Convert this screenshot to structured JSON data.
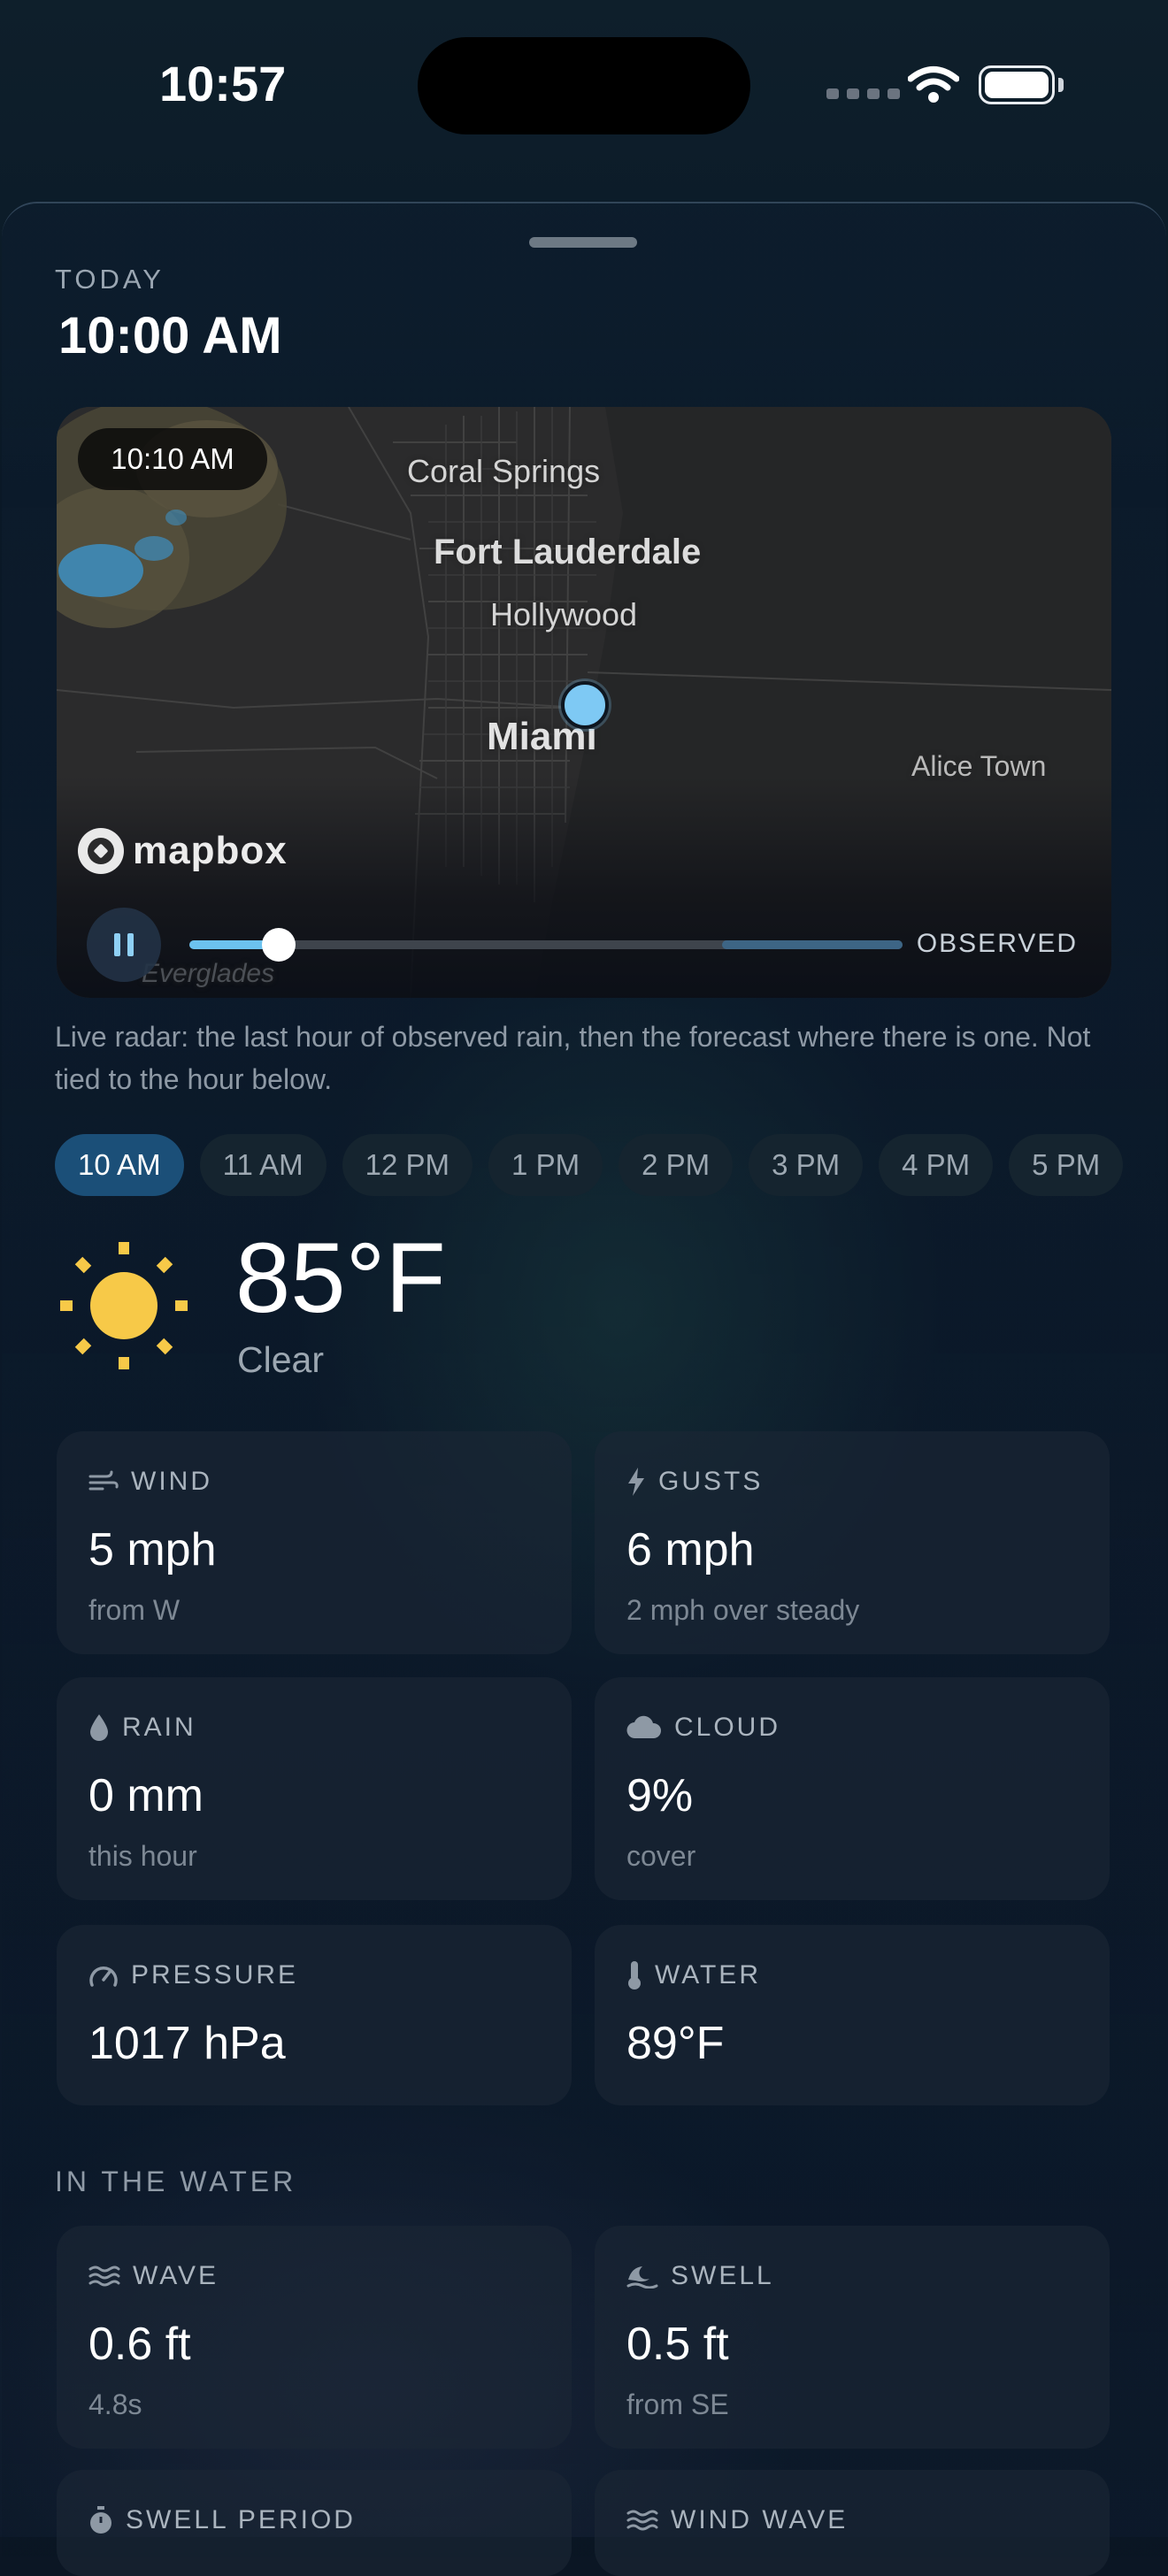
{
  "status_bar": {
    "time": "10:57"
  },
  "header": {
    "eyebrow": "TODAY",
    "time": "10:00 AM"
  },
  "radar": {
    "frame_time": "10:10 AM",
    "labels": {
      "coral_springs": "Coral Springs",
      "fort_lauderdale": "Fort Lauderdale",
      "hollywood": "Hollywood",
      "miami": "Miami",
      "alice_town": "Alice Town",
      "everglades": "Everglades"
    },
    "attribution": "mapbox",
    "progress": 0.125,
    "mode_label": "OBSERVED",
    "caption": "Live radar: the last hour of observed rain, then the forecast where there is one. Not tied to the hour below."
  },
  "hours": [
    "10 AM",
    "11 AM",
    "12 PM",
    "1 PM",
    "2 PM",
    "3 PM",
    "4 PM",
    "5 PM"
  ],
  "selected_hour": "10 AM",
  "current": {
    "icon": "sun-icon",
    "temperature": "85°F",
    "condition": "Clear"
  },
  "metrics": {
    "wind": {
      "label": "WIND",
      "value": "5 mph",
      "sub": "from W",
      "icon": "wind-icon"
    },
    "gusts": {
      "label": "GUSTS",
      "value": "6 mph",
      "sub": "2 mph over steady",
      "icon": "lightning-icon"
    },
    "rain": {
      "label": "RAIN",
      "value": "0 mm",
      "sub": "this hour",
      "icon": "droplet-icon"
    },
    "cloud": {
      "label": "CLOUD",
      "value": "9%",
      "sub": "cover",
      "icon": "cloud-icon"
    },
    "pressure": {
      "label": "PRESSURE",
      "value": "1017 hPa",
      "icon": "gauge-icon"
    },
    "water": {
      "label": "WATER",
      "value": "89°F",
      "icon": "thermometer-icon"
    }
  },
  "water_section": {
    "title": "IN THE WATER",
    "wave": {
      "label": "WAVE",
      "value": "0.6 ft",
      "sub": "4.8s",
      "icon": "waves-icon"
    },
    "swell": {
      "label": "SWELL",
      "value": "0.5 ft",
      "sub": "from SE",
      "icon": "swell-icon"
    },
    "swell_period": {
      "label": "SWELL PERIOD",
      "icon": "timer-icon"
    },
    "wind_wave": {
      "label": "WIND WAVE",
      "icon": "waves-icon"
    }
  },
  "colors": {
    "accent": "#6cc2ef",
    "sun": "#f7c948",
    "chip_active": "#1b4f78"
  }
}
